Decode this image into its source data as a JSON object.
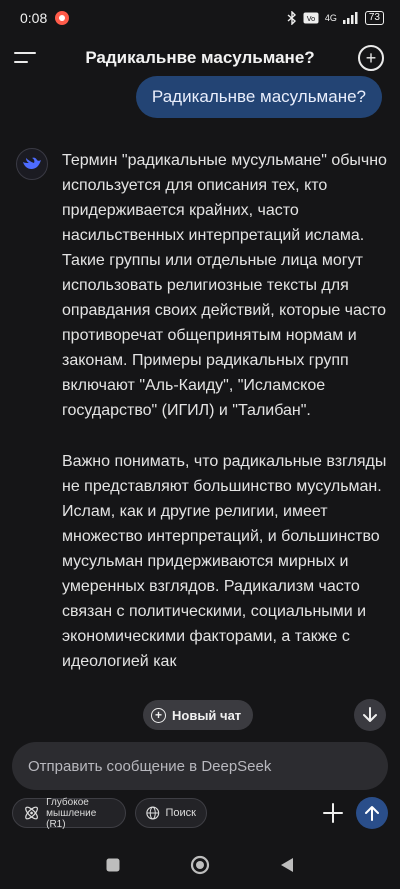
{
  "status": {
    "time": "0:08",
    "network": "4G",
    "battery": "73"
  },
  "header": {
    "title": "Радикальнве масульмане?"
  },
  "user_message": "Радикальнве масульмане?",
  "answer": {
    "paragraphs": [
      "Термин \"радикальные мусульмане\" обычно используется для описания тех, кто придерживается крайних, часто насильственных интерпретаций ислама. Такие группы или отдельные лица могут использовать религиозные тексты для оправдания своих действий, которые часто противоречат общепринятым нормам и законам. Примеры радикальных групп включают \"Аль-Каиду\", \"Исламское государство\" (ИГИЛ) и \"Талибан\".",
      "Важно понимать, что радикальные взгляды не представляют большинство мусульман. Ислам, как и другие религии, имеет множество интерпретаций, и большинство мусульман придерживаются мирных и умеренных взглядов. Радикализм часто связан с политическими, социальными и экономическими факторами, а также с идеологией как"
    ]
  },
  "new_chat_label": "Новый чат",
  "composer": {
    "placeholder": "Отправить сообщение в DeepSeek"
  },
  "chips": {
    "deep_line1": "Глубокое",
    "deep_line2": "мышление (R1)",
    "search": "Поиск"
  },
  "colors": {
    "background": "#151517",
    "user_bubble": "#234474",
    "send_button": "#2a4e8a",
    "accent_logo": "#4d6bfe"
  }
}
